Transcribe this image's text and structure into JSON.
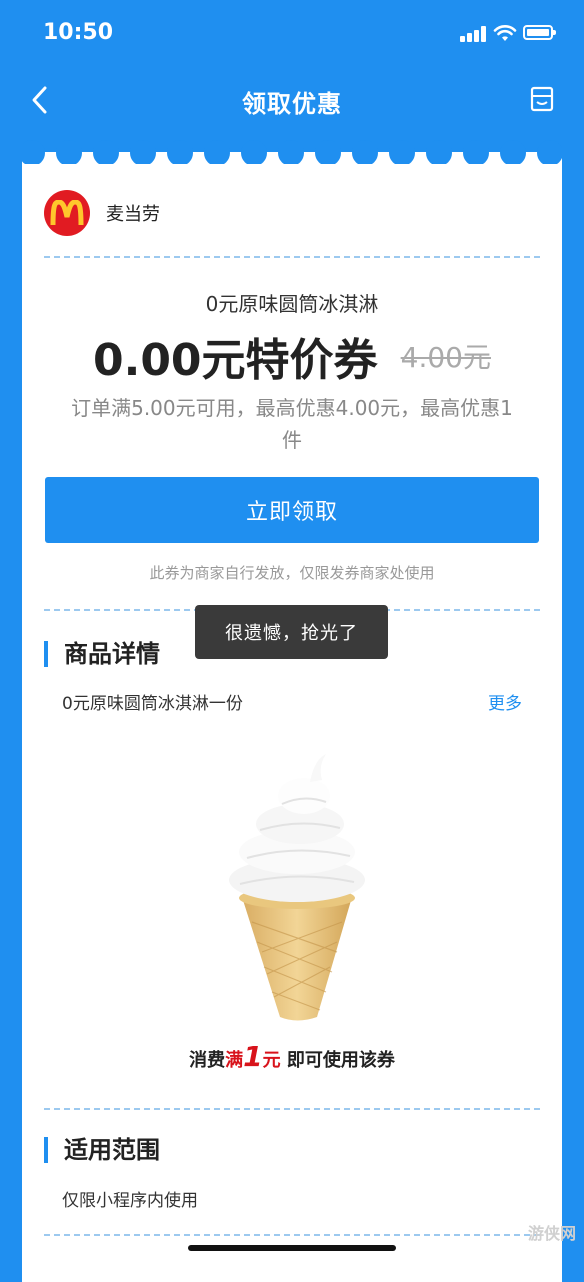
{
  "status": {
    "time": "10:50"
  },
  "nav": {
    "title": "领取优惠"
  },
  "merchant": {
    "name": "麦当劳"
  },
  "coupon": {
    "subtitle": "0元原味圆筒冰淇淋",
    "title": "0.00元特价券",
    "original_price": "4.00元",
    "condition": "订单满5.00元可用，最高优惠4.00元，最高优惠1件",
    "claim_label": "立即领取",
    "note": "此券为商家自行发放，仅限发券商家处使用"
  },
  "toast": "很遗憾，抢光了",
  "details": {
    "heading": "商品详情",
    "text": "0元原味圆筒冰淇淋一份",
    "more": "更多",
    "promo_prefix": "消费",
    "promo_red": "满",
    "promo_num": "1",
    "promo_unit": "元",
    "promo_suffix": " 即可使用该券"
  },
  "scope": {
    "heading": "适用范围",
    "text": "仅限小程序内使用"
  },
  "watermark": "游侠网",
  "colors": {
    "brand": "#1f8ff0",
    "mcd_red": "#e11b22",
    "mcd_yellow": "#ffc72c"
  }
}
